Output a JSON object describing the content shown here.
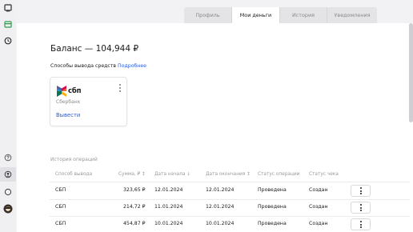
{
  "tabs": [
    {
      "label": "Профиль"
    },
    {
      "label": "Мои деньги"
    },
    {
      "label": "История"
    },
    {
      "label": "Уведомления"
    }
  ],
  "balance": {
    "label": "Баланс — 104,944 ₽"
  },
  "withdraw_methods": {
    "label": "Способы вывода средств",
    "link": "Подробнее"
  },
  "card": {
    "name": "сбп",
    "bank": "Сбербанк",
    "action": "Вывести"
  },
  "history": {
    "title": "История операций",
    "columns": [
      "Способ вывода",
      "Сумма, ₽",
      "Дата начала",
      "Дата окончания",
      "Статус операции",
      "Статус чека"
    ],
    "rows": [
      {
        "method": "СБП",
        "amount": "323,65 ₽",
        "start": "12.01.2024",
        "end": "12.01.2024",
        "status": "Проведена",
        "receipt": "Создан"
      },
      {
        "method": "СБП",
        "amount": "214,72 ₽",
        "start": "11.01.2024",
        "end": "12.01.2024",
        "status": "Проведена",
        "receipt": "Создан"
      },
      {
        "method": "СБП",
        "amount": "454,87 ₽",
        "start": "10.01.2024",
        "end": "10.01.2024",
        "status": "Проведена",
        "receipt": "Создан"
      }
    ]
  },
  "sidebar_icons": [
    "monitor-icon",
    "wallet-icon",
    "clock-icon",
    "help-icon",
    "user-icon",
    "chat-icon",
    "avatar"
  ]
}
